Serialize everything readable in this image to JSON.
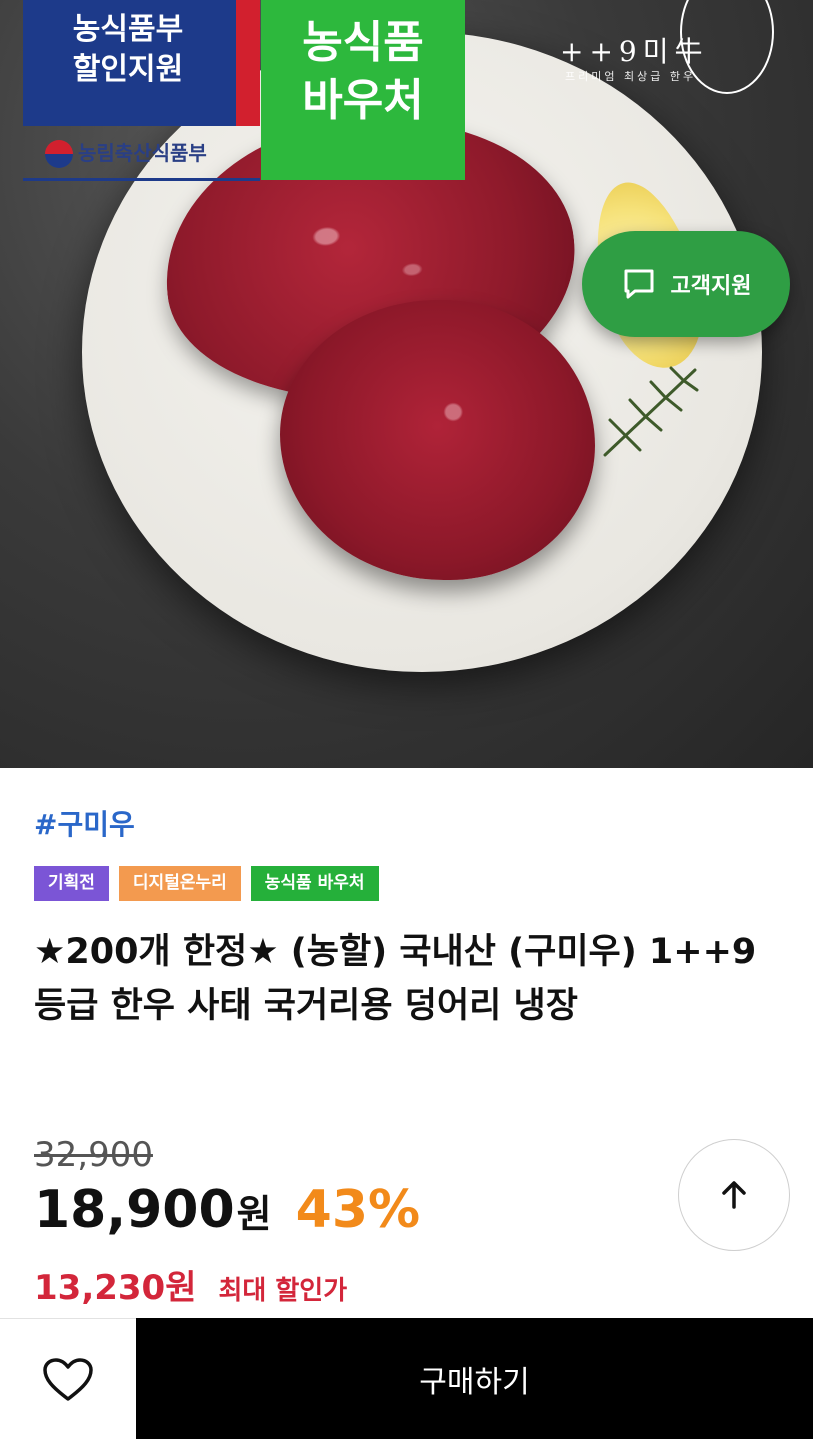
{
  "hero": {
    "badge_mafra_line1": "농식품부",
    "badge_mafra_line2": "할인지원",
    "ministry": "농림축산식품부",
    "badge_voucher_line1": "농식품",
    "badge_voucher_line2": "바우처",
    "brand_main": "++9미",
    "brand_char": "牛",
    "brand_sub": "프리미엄 최상급 한우",
    "support_label": "고객지원"
  },
  "product": {
    "tag": "#구미우",
    "chips": [
      "기획전",
      "디지털온누리",
      "농식품 바우처"
    ],
    "title": "★200개 한정★ (농할) 국내산 (구미우) 1++9등급 한우 사태 국거리용 덩어리 냉장",
    "original_price": "32,900",
    "price": "18,900",
    "price_unit": "원",
    "discount": "43%",
    "max_price": "13,230원",
    "max_label": "최대 할인가"
  },
  "actions": {
    "buy_label": "구매하기"
  },
  "colors": {
    "tag": "#2a67c9",
    "discount": "#f28a1a",
    "max_price": "#d3263a",
    "support": "#2f9e44"
  },
  "icons": [
    "chat-icon",
    "arrow-up-icon",
    "heart-icon"
  ]
}
